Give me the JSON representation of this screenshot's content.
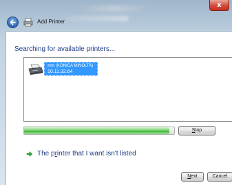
{
  "window": {
    "title": "Add Printer",
    "close_glyph": "x",
    "back_icon": "back-arrow-icon",
    "title_icon": "printer-icon"
  },
  "main": {
    "heading": "Searching for available printers...",
    "printers": [
      {
        "name": "(KONICA MINOLTA)",
        "ip": "10.11.32.64",
        "icon": "printer-icon",
        "selected": true
      }
    ],
    "progress": {
      "fraction": 0.97,
      "color": "#43b33b"
    },
    "stop_button": {
      "label": "Stop",
      "accesskey": "S"
    },
    "not_listed_link": {
      "label": "The printer that I want isn't listed",
      "icon": "green-arrow-icon"
    }
  },
  "footer": {
    "next_button": {
      "label": "Next",
      "accesskey": "N"
    },
    "cancel_button": {
      "label": "Cancel"
    }
  },
  "colors": {
    "heading": "#1f3c88",
    "selection": "#3399ff",
    "close": "#d4493a"
  }
}
